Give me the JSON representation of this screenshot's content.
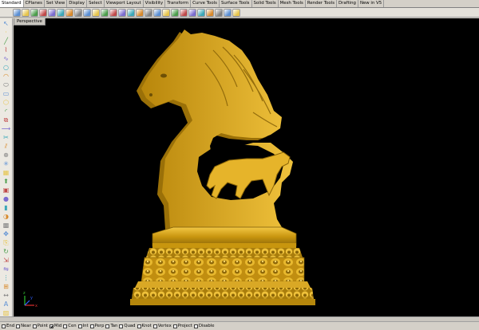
{
  "tabs": [
    "Standard",
    "CPlanes",
    "Set View",
    "Display",
    "Select",
    "Viewport Layout",
    "Visibility",
    "Transform",
    "Curve Tools",
    "Surface Tools",
    "Solid Tools",
    "Mesh Tools",
    "Render Tools",
    "Drafting",
    "New in V5"
  ],
  "active_tab": "Standard",
  "viewport": {
    "title": "Perspective"
  },
  "axes": {
    "x": "x",
    "y": "y",
    "z": "z"
  },
  "osnaps": [
    {
      "label": "End",
      "checked": false
    },
    {
      "label": "Near",
      "checked": false
    },
    {
      "label": "Point",
      "checked": false
    },
    {
      "label": "Mid",
      "checked": true
    },
    {
      "label": "Cen",
      "checked": false
    },
    {
      "label": "Int",
      "checked": false
    },
    {
      "label": "Perp",
      "checked": false
    },
    {
      "label": "Tan",
      "checked": false
    },
    {
      "label": "Quad",
      "checked": false
    },
    {
      "label": "Knot",
      "checked": false
    },
    {
      "label": "Vertex",
      "checked": false
    },
    {
      "label": "Project",
      "checked": false
    },
    {
      "label": "Disable",
      "checked": false
    }
  ],
  "colors": {
    "model": "#d4a017",
    "model_shadow": "#8a6508",
    "model_light": "#f2c640",
    "viewport_bg": "#000000"
  },
  "toolbar_icons": [
    "new-icon",
    "open-icon",
    "save-icon",
    "print-icon",
    "cut-icon",
    "copy-icon",
    "paste-icon",
    "undo-icon",
    "redo-icon",
    "pan-icon",
    "rotate-view-icon",
    "zoom-icon",
    "zoom-window-icon",
    "zoom-extents-icon",
    "zoom-selected-icon",
    "viewport-4-icon",
    "options-icon",
    "layer-icon",
    "properties-icon",
    "wireframe-icon",
    "shaded-icon",
    "rendered-icon",
    "render-icon",
    "material-icon",
    "light-icon",
    "help-icon"
  ],
  "left_icons": [
    "select-icon",
    "point-icon",
    "line-icon",
    "polyline-icon",
    "curve-icon",
    "circle-icon",
    "arc-icon",
    "ellipse-icon",
    "rectangle-icon",
    "polygon-icon",
    "fillet-icon",
    "offset-icon",
    "extend-icon",
    "trim-icon",
    "split-icon",
    "join-icon",
    "explode-icon",
    "surface-icon",
    "extrude-icon",
    "box-icon",
    "sphere-icon",
    "cylinder-icon",
    "boolean-icon",
    "mesh-icon",
    "move-icon",
    "copy-icon",
    "rotate-icon",
    "scale-icon",
    "mirror-icon",
    "array-icon",
    "group-icon",
    "dimension-icon",
    "text-icon",
    "hatch-icon",
    "analyze-icon",
    "render-icon"
  ]
}
